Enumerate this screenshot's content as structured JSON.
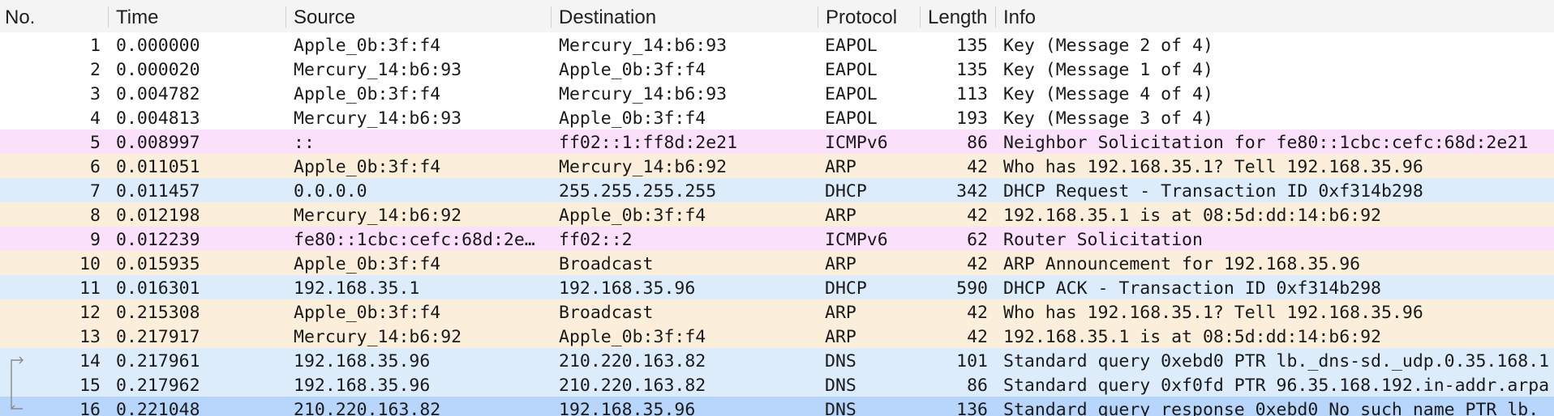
{
  "columns": {
    "no": "No.",
    "time": "Time",
    "source": "Source",
    "destination": "Destination",
    "protocol": "Protocol",
    "length": "Length",
    "info": "Info"
  },
  "colors": {
    "default": "#ffffff",
    "icmpv6": "#fbe0fb",
    "arp": "#fbefdc",
    "udp": "#dcecfb",
    "selected": "#b8d6fb"
  },
  "packets": [
    {
      "no": "1",
      "time": "0.000000",
      "source": "Apple_0b:3f:f4",
      "destination": "Mercury_14:b6:93",
      "protocol": "EAPOL",
      "length": "135",
      "info": "Key (Message 2 of 4)",
      "color": "default"
    },
    {
      "no": "2",
      "time": "0.000020",
      "source": "Mercury_14:b6:93",
      "destination": "Apple_0b:3f:f4",
      "protocol": "EAPOL",
      "length": "135",
      "info": "Key (Message 1 of 4)",
      "color": "default"
    },
    {
      "no": "3",
      "time": "0.004782",
      "source": "Apple_0b:3f:f4",
      "destination": "Mercury_14:b6:93",
      "protocol": "EAPOL",
      "length": "113",
      "info": "Key (Message 4 of 4)",
      "color": "default"
    },
    {
      "no": "4",
      "time": "0.004813",
      "source": "Mercury_14:b6:93",
      "destination": "Apple_0b:3f:f4",
      "protocol": "EAPOL",
      "length": "193",
      "info": "Key (Message 3 of 4)",
      "color": "default"
    },
    {
      "no": "5",
      "time": "0.008997",
      "source": "::",
      "destination": "ff02::1:ff8d:2e21",
      "protocol": "ICMPv6",
      "length": "86",
      "info": "Neighbor Solicitation for fe80::1cbc:cefc:68d:2e21",
      "color": "icmpv6"
    },
    {
      "no": "6",
      "time": "0.011051",
      "source": "Apple_0b:3f:f4",
      "destination": "Mercury_14:b6:92",
      "protocol": "ARP",
      "length": "42",
      "info": "Who has 192.168.35.1? Tell 192.168.35.96",
      "color": "arp"
    },
    {
      "no": "7",
      "time": "0.011457",
      "source": "0.0.0.0",
      "destination": "255.255.255.255",
      "protocol": "DHCP",
      "length": "342",
      "info": "DHCP Request  - Transaction ID 0xf314b298",
      "color": "udp"
    },
    {
      "no": "8",
      "time": "0.012198",
      "source": "Mercury_14:b6:92",
      "destination": "Apple_0b:3f:f4",
      "protocol": "ARP",
      "length": "42",
      "info": "192.168.35.1 is at 08:5d:dd:14:b6:92",
      "color": "arp"
    },
    {
      "no": "9",
      "time": "0.012239",
      "source": "fe80::1cbc:cefc:68d:2e…",
      "destination": "ff02::2",
      "protocol": "ICMPv6",
      "length": "62",
      "info": "Router Solicitation",
      "color": "icmpv6"
    },
    {
      "no": "10",
      "time": "0.015935",
      "source": "Apple_0b:3f:f4",
      "destination": "Broadcast",
      "protocol": "ARP",
      "length": "42",
      "info": "ARP Announcement for 192.168.35.96",
      "color": "arp"
    },
    {
      "no": "11",
      "time": "0.016301",
      "source": "192.168.35.1",
      "destination": "192.168.35.96",
      "protocol": "DHCP",
      "length": "590",
      "info": "DHCP ACK      - Transaction ID 0xf314b298",
      "color": "udp"
    },
    {
      "no": "12",
      "time": "0.215308",
      "source": "Apple_0b:3f:f4",
      "destination": "Broadcast",
      "protocol": "ARP",
      "length": "42",
      "info": "Who has 192.168.35.1? Tell 192.168.35.96",
      "color": "arp"
    },
    {
      "no": "13",
      "time": "0.217917",
      "source": "Mercury_14:b6:92",
      "destination": "Apple_0b:3f:f4",
      "protocol": "ARP",
      "length": "42",
      "info": "192.168.35.1 is at 08:5d:dd:14:b6:92",
      "color": "arp"
    },
    {
      "no": "14",
      "time": "0.217961",
      "source": "192.168.35.96",
      "destination": "210.220.163.82",
      "protocol": "DNS",
      "length": "101",
      "info": "Standard query 0xebd0 PTR lb._dns-sd._udp.0.35.168.1",
      "color": "udp",
      "related": "request"
    },
    {
      "no": "15",
      "time": "0.217962",
      "source": "192.168.35.96",
      "destination": "210.220.163.82",
      "protocol": "DNS",
      "length": "86",
      "info": "Standard query 0xf0fd PTR 96.35.168.192.in-addr.arpa",
      "color": "udp",
      "related": "line"
    },
    {
      "no": "16",
      "time": "0.221048",
      "source": "210.220.163.82",
      "destination": "192.168.35.96",
      "protocol": "DNS",
      "length": "136",
      "info": "Standard query response 0xebd0 No such name PTR lb._",
      "color": "selected",
      "related": "response"
    }
  ]
}
